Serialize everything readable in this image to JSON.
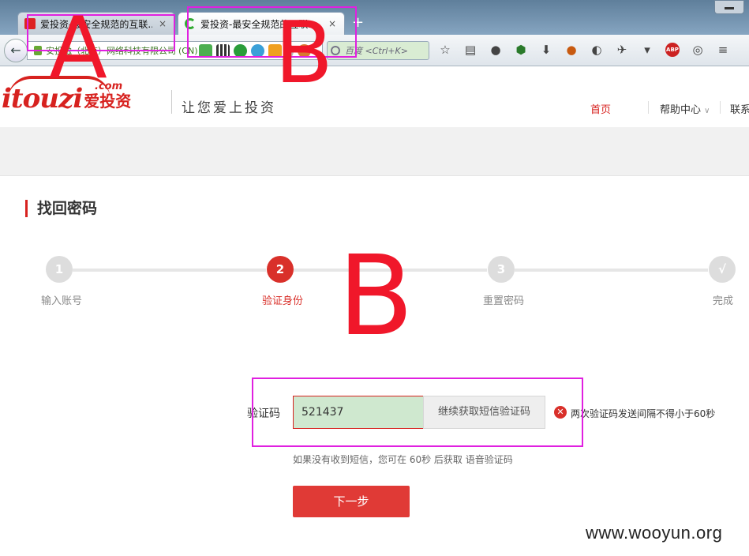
{
  "browser": {
    "tabs": [
      {
        "title": "爱投资-最安全规范的互联...",
        "active": false
      },
      {
        "title": "爱投资-最安全规范的互联...",
        "active": true
      }
    ],
    "close_glyph": "×",
    "new_tab_glyph": "+",
    "url_cert_text": "安投融（北京）网络科技有限公司",
    "url_country": "(CN)",
    "search_placeholder": "百度 <Ctrl+K>",
    "abp_label": "ABP"
  },
  "site": {
    "logo_latin": "itouzi",
    "logo_dotcom": ".com",
    "logo_cn": "爱投资",
    "slogan": "让您爱上投资",
    "nav": {
      "home": "首页",
      "help": "帮助中心",
      "contact": "联系"
    }
  },
  "page": {
    "title": "找回密码",
    "steps": [
      {
        "number": "1",
        "label": "输入账号",
        "state": "done"
      },
      {
        "number": "2",
        "label": "验证身份",
        "state": "current"
      },
      {
        "number": "3",
        "label": "重置密码",
        "state": "todo"
      },
      {
        "number": "√",
        "label": "完成",
        "state": "todo"
      }
    ],
    "form": {
      "code_label": "验证码",
      "code_value": "521437",
      "sms_button": "继续获取短信验证码",
      "error_message": "两次验证码发送间隔不得小于60秒",
      "hint": "如果没有收到短信，您可在 60秒 后获取 语音验证码",
      "next_button": "下一步"
    }
  },
  "annotations": {
    "letter_a": "A",
    "letter_b_tab": "B",
    "letter_b_main": "B",
    "watermark": "www.wooyun.org",
    "box_color": "#e020e0",
    "letter_color": "#f0172a"
  },
  "colors": {
    "brand_red": "#d7221f",
    "code_input_bg": "#cfe8cf"
  }
}
